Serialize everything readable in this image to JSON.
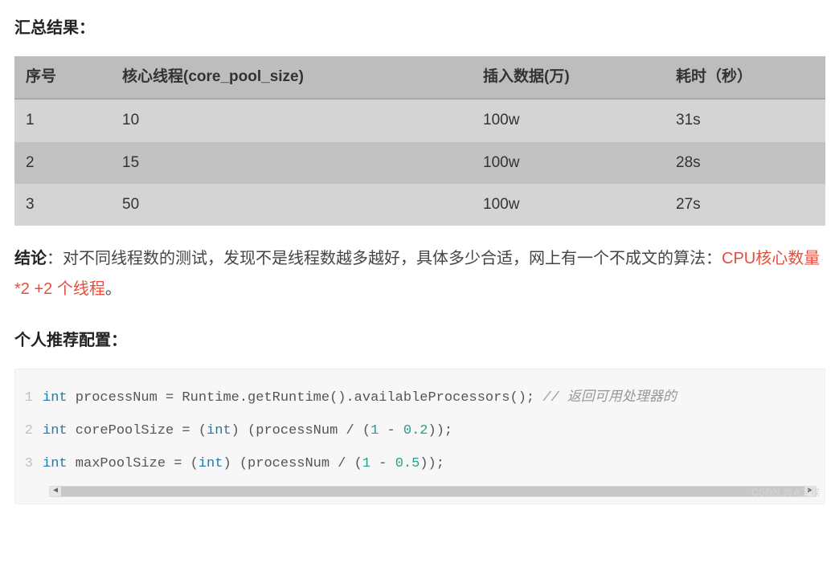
{
  "heading_summary": "汇总结果：",
  "table": {
    "headers": [
      "序号",
      "核心线程(core_pool_size)",
      "插入数据(万)",
      "耗时（秒）"
    ],
    "rows": [
      {
        "no": "1",
        "core": "10",
        "insert": "100w",
        "time": "31s"
      },
      {
        "no": "2",
        "core": "15",
        "insert": "100w",
        "time": "28s"
      },
      {
        "no": "3",
        "core": "50",
        "insert": "100w",
        "time": "27s"
      }
    ]
  },
  "conclusion": {
    "label": "结论",
    "text_before": "：对不同线程数的测试，发现不是线程数越多越好，具体多少合适，网上有一个不成文的算法：",
    "formula": "CPU核心数量*2 +2 个线程",
    "text_after": "。"
  },
  "heading_config": "个人推荐配置：",
  "code": {
    "lines": [
      {
        "n": "1",
        "tokens": [
          {
            "t": "int",
            "c": "kw"
          },
          {
            "t": " processNum = Runtime.getRuntime().availableProcessors(); ",
            "c": "plain"
          },
          {
            "t": "// 返回可用处理器的",
            "c": "comment"
          }
        ]
      },
      {
        "n": "2",
        "tokens": [
          {
            "t": "int",
            "c": "kw"
          },
          {
            "t": " corePoolSize = (",
            "c": "plain"
          },
          {
            "t": "int",
            "c": "kw"
          },
          {
            "t": ") (processNum / (",
            "c": "plain"
          },
          {
            "t": "1",
            "c": "num"
          },
          {
            "t": " - ",
            "c": "plain"
          },
          {
            "t": "0.2",
            "c": "num"
          },
          {
            "t": "));",
            "c": "plain"
          }
        ]
      },
      {
        "n": "3",
        "tokens": [
          {
            "t": "int",
            "c": "kw"
          },
          {
            "t": " maxPoolSize = (",
            "c": "plain"
          },
          {
            "t": "int",
            "c": "kw"
          },
          {
            "t": ") (processNum / (",
            "c": "plain"
          },
          {
            "t": "1",
            "c": "num"
          },
          {
            "t": " - ",
            "c": "plain"
          },
          {
            "t": "0.5",
            "c": "num"
          },
          {
            "t": "));",
            "c": "plain"
          }
        ]
      }
    ]
  },
  "scrollbar": {
    "left": "◀",
    "right": "▶"
  },
  "watermark": "CSDN @A尘埃"
}
